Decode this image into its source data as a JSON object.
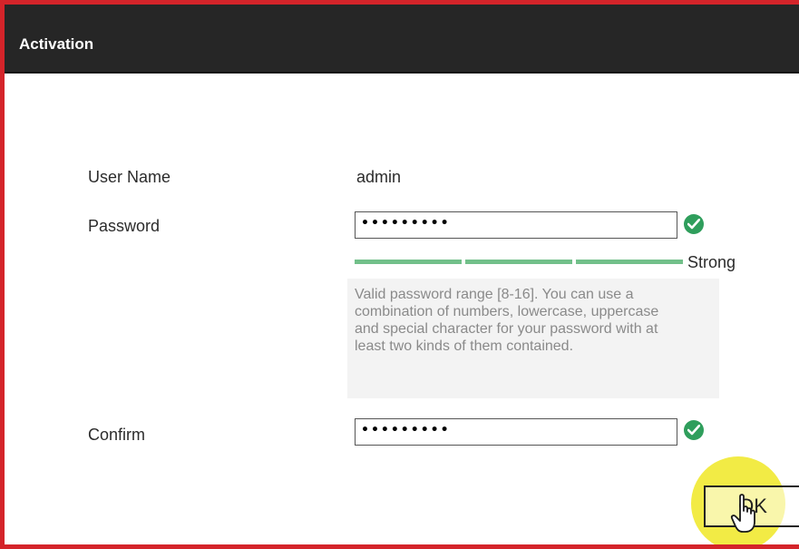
{
  "window": {
    "title": "Activation"
  },
  "form": {
    "username_label": "User Name",
    "username_value": "admin",
    "password_label": "Password",
    "password_value": "•••••••••",
    "password_valid_icon": "check-circle-icon",
    "strength_label": "Strong",
    "strength_level": "3 of 3",
    "hint": "Valid password range [8-16]. You can use a combination of numbers, lowercase, uppercase and special character for your password with at least two kinds of them contained.",
    "confirm_label": "Confirm",
    "confirm_value": "•••••••••",
    "confirm_valid_icon": "check-circle-icon"
  },
  "actions": {
    "ok_label": "OK",
    "cursor_icon": "hand-pointer-icon"
  },
  "colors": {
    "border_accent": "#d4242a",
    "titlebar": "#262626",
    "valid_green": "#2f9e5c",
    "strength_green": "#72c08a",
    "highlight_yellow": "#f1ea3b"
  }
}
